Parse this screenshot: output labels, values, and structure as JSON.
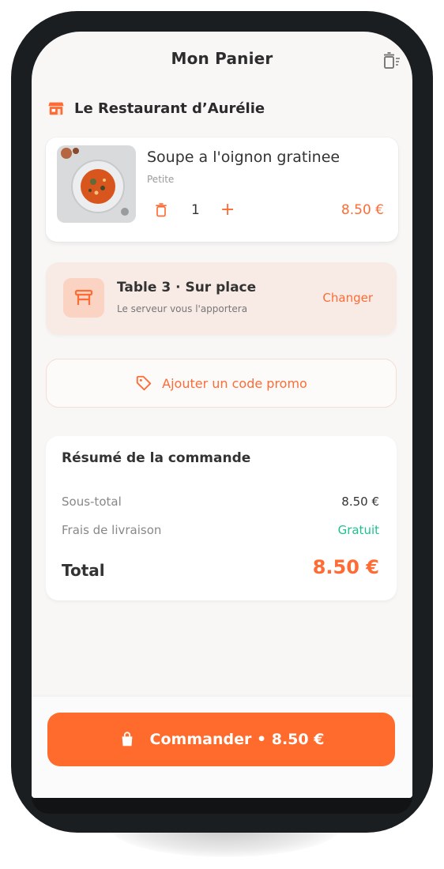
{
  "header": {
    "title": "Mon Panier"
  },
  "restaurant": {
    "name": "Le Restaurant d’Aurélie"
  },
  "cart": {
    "items": [
      {
        "name": "Soupe a l'oignon gratinee",
        "variant": "Petite",
        "quantity": "1",
        "price": "8.50 €"
      }
    ]
  },
  "table": {
    "title": "Table 3 · Sur place",
    "subtitle": "Le serveur vous l'apportera",
    "change_label": "Changer"
  },
  "promo": {
    "label": "Ajouter un code promo"
  },
  "summary": {
    "title": "Résumé de la commande",
    "subtotal_label": "Sous-total",
    "subtotal_value": "8.50 €",
    "delivery_label": "Frais de livraison",
    "delivery_value": "Gratuit",
    "total_label": "Total",
    "total_value": "8.50 €"
  },
  "order_button": {
    "label": "Commander • 8.50 €"
  },
  "colors": {
    "accent": "#ff6b2c",
    "free": "#1fbf8f",
    "table_card_bg": "#f8ebe6",
    "frame": "#1b1e20"
  },
  "icons": {
    "header_action": "trash-icon",
    "restaurant": "store-icon",
    "table": "table-icon",
    "promo": "tag-icon",
    "order": "shopping-bag-icon"
  }
}
